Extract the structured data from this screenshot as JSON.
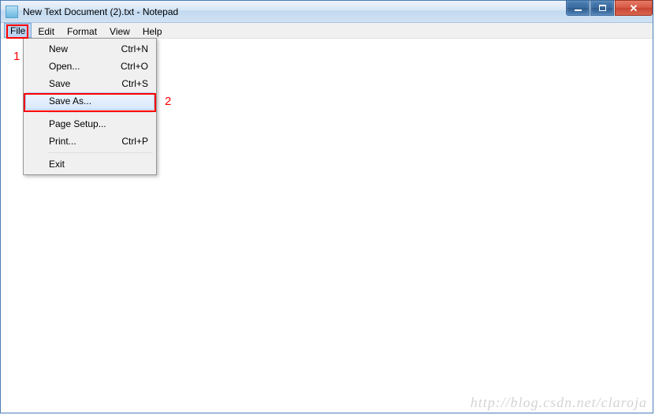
{
  "window": {
    "title": "New Text Document (2).txt - Notepad"
  },
  "menubar": {
    "items": [
      {
        "label": "File",
        "active": true
      },
      {
        "label": "Edit",
        "active": false
      },
      {
        "label": "Format",
        "active": false
      },
      {
        "label": "View",
        "active": false
      },
      {
        "label": "Help",
        "active": false
      }
    ]
  },
  "file_menu": {
    "items": [
      {
        "label": "New",
        "shortcut": "Ctrl+N"
      },
      {
        "label": "Open...",
        "shortcut": "Ctrl+O"
      },
      {
        "label": "Save",
        "shortcut": "Ctrl+S"
      },
      {
        "label": "Save As...",
        "shortcut": "",
        "highlighted": true
      },
      {
        "sep": true
      },
      {
        "label": "Page Setup...",
        "shortcut": ""
      },
      {
        "label": "Print...",
        "shortcut": "Ctrl+P"
      },
      {
        "sep": true
      },
      {
        "label": "Exit",
        "shortcut": ""
      }
    ]
  },
  "annotations": {
    "label1": "1",
    "label2": "2"
  },
  "watermark": "http://blog.csdn.net/claroja"
}
